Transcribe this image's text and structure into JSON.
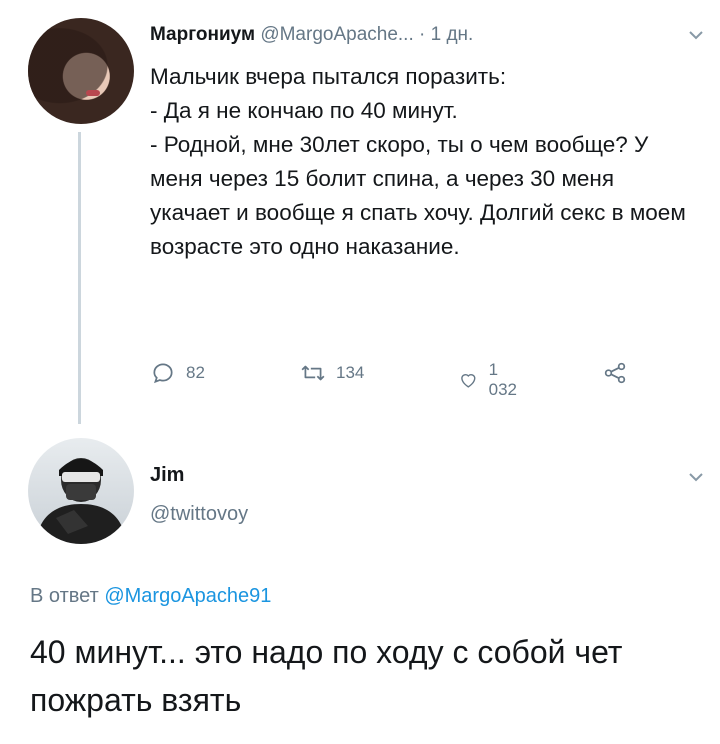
{
  "tweet": {
    "author_name": "Маргониум",
    "author_handle": "@MargoApache...",
    "time": "· 1 дн.",
    "text": "Мальчик вчера пытался поразить:\n- Да я не кончаю по 40 минут.\n- Родной, мне 30лет скоро, ты о чем вообще? У меня через 15 болит спина, а через 30 меня укачает и вообще я спать хочу. Долгий секс в моем возрасте это одно наказание.",
    "replies": "82",
    "retweets": "134",
    "likes": "1 032"
  },
  "reply": {
    "author_name": "Jim",
    "author_handle": "@twittovoy",
    "reply_prefix": "В ответ",
    "reply_mention": "@MargoApache91",
    "text": "40 минут... это надо по ходу с собой чет пожрать взять"
  },
  "icons": [
    "comment-icon",
    "retweet-icon",
    "like-icon",
    "share-icon",
    "chevron-down-icon"
  ],
  "colors": {
    "text": "#14171a",
    "muted": "#657786",
    "link": "#1b95e0",
    "line": "#ccd6dd"
  }
}
